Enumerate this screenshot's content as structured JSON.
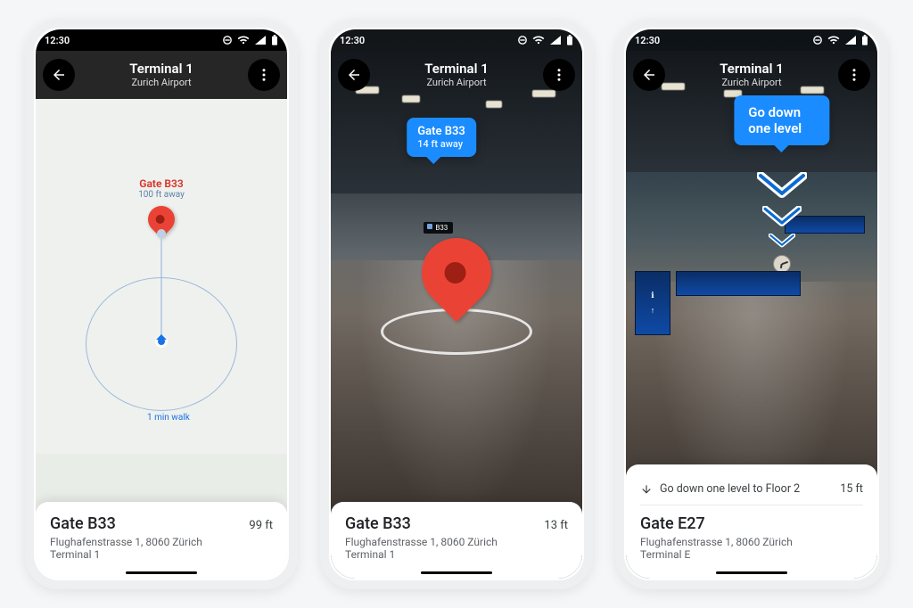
{
  "status": {
    "time": "12:30"
  },
  "common": {
    "header_title": "Terminal 1",
    "header_subtitle": "Zurich Airport"
  },
  "phone1": {
    "pin_title": "Gate B33",
    "pin_distance": "100 ft away",
    "walk_label": "1 min walk",
    "card_name": "Gate B33",
    "card_distance": "99 ft",
    "card_address": "Flughafenstrasse 1, 8060 Zürich",
    "card_subloc": "Terminal 1"
  },
  "phone2": {
    "callout_title": "Gate B33",
    "callout_distance": "14 ft away",
    "sign_label": "B33",
    "card_name": "Gate B33",
    "card_distance": "13 ft",
    "card_address": "Flughafenstrasse 1, 8060 Zürich",
    "card_subloc": "Terminal 1"
  },
  "phone3": {
    "callout_title": "Go down one level",
    "step_text": "Go down one level to Floor 2",
    "step_distance": "15 ft",
    "card_name": "Gate E27",
    "card_address": "Flughafenstrasse 1, 8060 Zürich",
    "card_subloc": "Terminal E"
  }
}
